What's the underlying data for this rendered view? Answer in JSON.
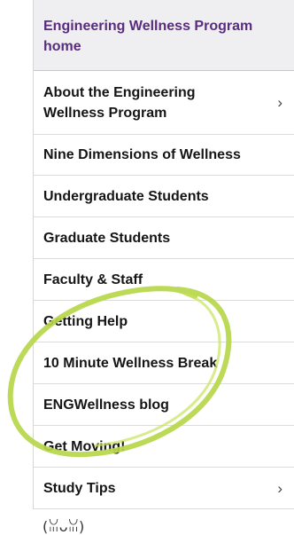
{
  "nav": {
    "home": "Engineering Wellness Program home",
    "items": [
      {
        "label": "About the Engineering Wellness Program",
        "has_submenu": true
      },
      {
        "label": "Nine Dimensions of Wellness",
        "has_submenu": false
      },
      {
        "label": "Undergraduate Students",
        "has_submenu": false
      },
      {
        "label": "Graduate Students",
        "has_submenu": false
      },
      {
        "label": "Faculty & Staff",
        "has_submenu": false
      },
      {
        "label": "Getting Help",
        "has_submenu": false
      },
      {
        "label": "10 Minute Wellness Break",
        "has_submenu": false
      },
      {
        "label": "ENGWellness blog",
        "has_submenu": false
      },
      {
        "label": "Get Moving!",
        "has_submenu": false
      },
      {
        "label": "Study Tips",
        "has_submenu": true
      }
    ],
    "chevron_glyph": "›"
  },
  "footer_emoji": "(ꈍᴗꈍ)",
  "colors": {
    "home_text": "#5a2c7f",
    "home_bg": "#efeff1",
    "highlight_circle": "#b7d64a"
  }
}
